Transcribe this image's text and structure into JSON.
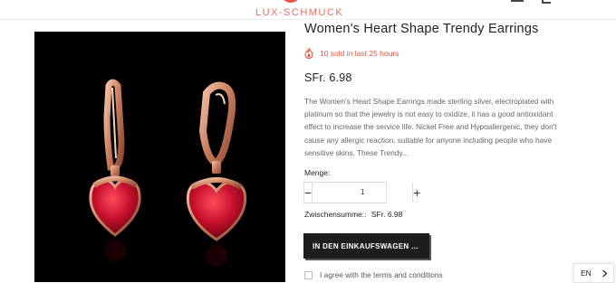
{
  "header": {
    "logo_text": "LUX-SCHMUCK",
    "icons": [
      "menu-icon",
      "cart-icon"
    ]
  },
  "product": {
    "title": "Women's Heart Shape Trendy Earrings",
    "sold_text": "10 sold in last 25 hours",
    "price": "SFr. 6.98",
    "description": "The Women's Heart Shape Earrings made sterling silver, electroplated with platinum so that the jewelry is not easy to oxidize, it has a good antioxidant effect to increase the service life. Nickel Free and Hypoallergenic, they don't cause any allergic reaction, suitable for anyone including people who have sensitive skins. These Trendy...",
    "image_alt": "Rose gold heart shaped earrings with red stones"
  },
  "quantity": {
    "label": "Menge:",
    "value": "1",
    "minus": "−",
    "plus": "+"
  },
  "subtotal": {
    "label": "Zwischensumme::",
    "value": "SFr. 6.98"
  },
  "cart_button": {
    "label": "IN DEN EINKAUFSWAGEN ..."
  },
  "terms": {
    "label": "I agree with the terms and conditions",
    "checked": false
  },
  "language": {
    "current": "EN"
  },
  "colors": {
    "accent": "#e8553e",
    "button_bg": "#1d1d1d",
    "image_bg": "#000000",
    "earring_metal": "#d99679",
    "stone": "#c8102e"
  }
}
